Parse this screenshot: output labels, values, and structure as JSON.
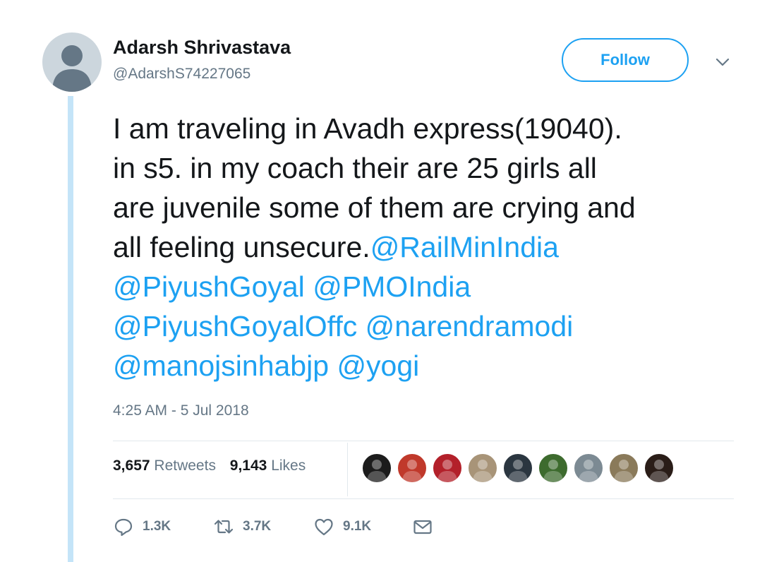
{
  "author": {
    "name": "Adarsh Shrivastava",
    "handle": "@AdarshS74227065"
  },
  "follow_button": {
    "label": "Follow"
  },
  "tweet": {
    "lines": [
      [
        {
          "text": "I am traveling in Avadh express(19040).",
          "mention": false
        }
      ],
      [
        {
          "text": "in s5. in my coach their are 25 girls all",
          "mention": false
        }
      ],
      [
        {
          "text": "are juvenile some of them are crying and",
          "mention": false
        }
      ],
      [
        {
          "text": "all feeling unsecure.",
          "mention": false
        },
        {
          "text": "@RailMinIndia",
          "mention": true
        }
      ],
      [
        {
          "text": "@PiyushGoyal",
          "mention": true
        },
        {
          "text": " ",
          "mention": false
        },
        {
          "text": "@PMOIndia",
          "mention": true
        }
      ],
      [
        {
          "text": "@PiyushGoyalOffc",
          "mention": true
        },
        {
          "text": " ",
          "mention": false
        },
        {
          "text": "@narendramodi",
          "mention": true
        }
      ],
      [
        {
          "text": "@manojsinhabjp",
          "mention": true
        },
        {
          "text": " ",
          "mention": false
        },
        {
          "text": "@yogi",
          "mention": true
        }
      ]
    ],
    "timestamp": "4:25 AM - 5 Jul 2018"
  },
  "stats": {
    "retweets_count": "3,657",
    "retweets_label": "Retweets",
    "likes_count": "9,143",
    "likes_label": "Likes"
  },
  "likers": [
    {
      "name": "liker-1",
      "color": "#1c1c1c"
    },
    {
      "name": "liker-2",
      "color": "#c0392b"
    },
    {
      "name": "liker-3",
      "color": "#b3202a"
    },
    {
      "name": "liker-4",
      "color": "#a89478"
    },
    {
      "name": "liker-5",
      "color": "#2b3640"
    },
    {
      "name": "liker-6",
      "color": "#3d6b2e"
    },
    {
      "name": "liker-7",
      "color": "#7c8a93"
    },
    {
      "name": "liker-8",
      "color": "#8a7a5a"
    },
    {
      "name": "liker-9",
      "color": "#2a1d18"
    }
  ],
  "actions": {
    "reply_count": "1.3K",
    "retweet_count": "3.7K",
    "like_count": "9.1K"
  },
  "colors": {
    "accent": "#1da1f2",
    "text": "#14171a",
    "muted": "#657786",
    "thread": "#c4e4f8"
  }
}
